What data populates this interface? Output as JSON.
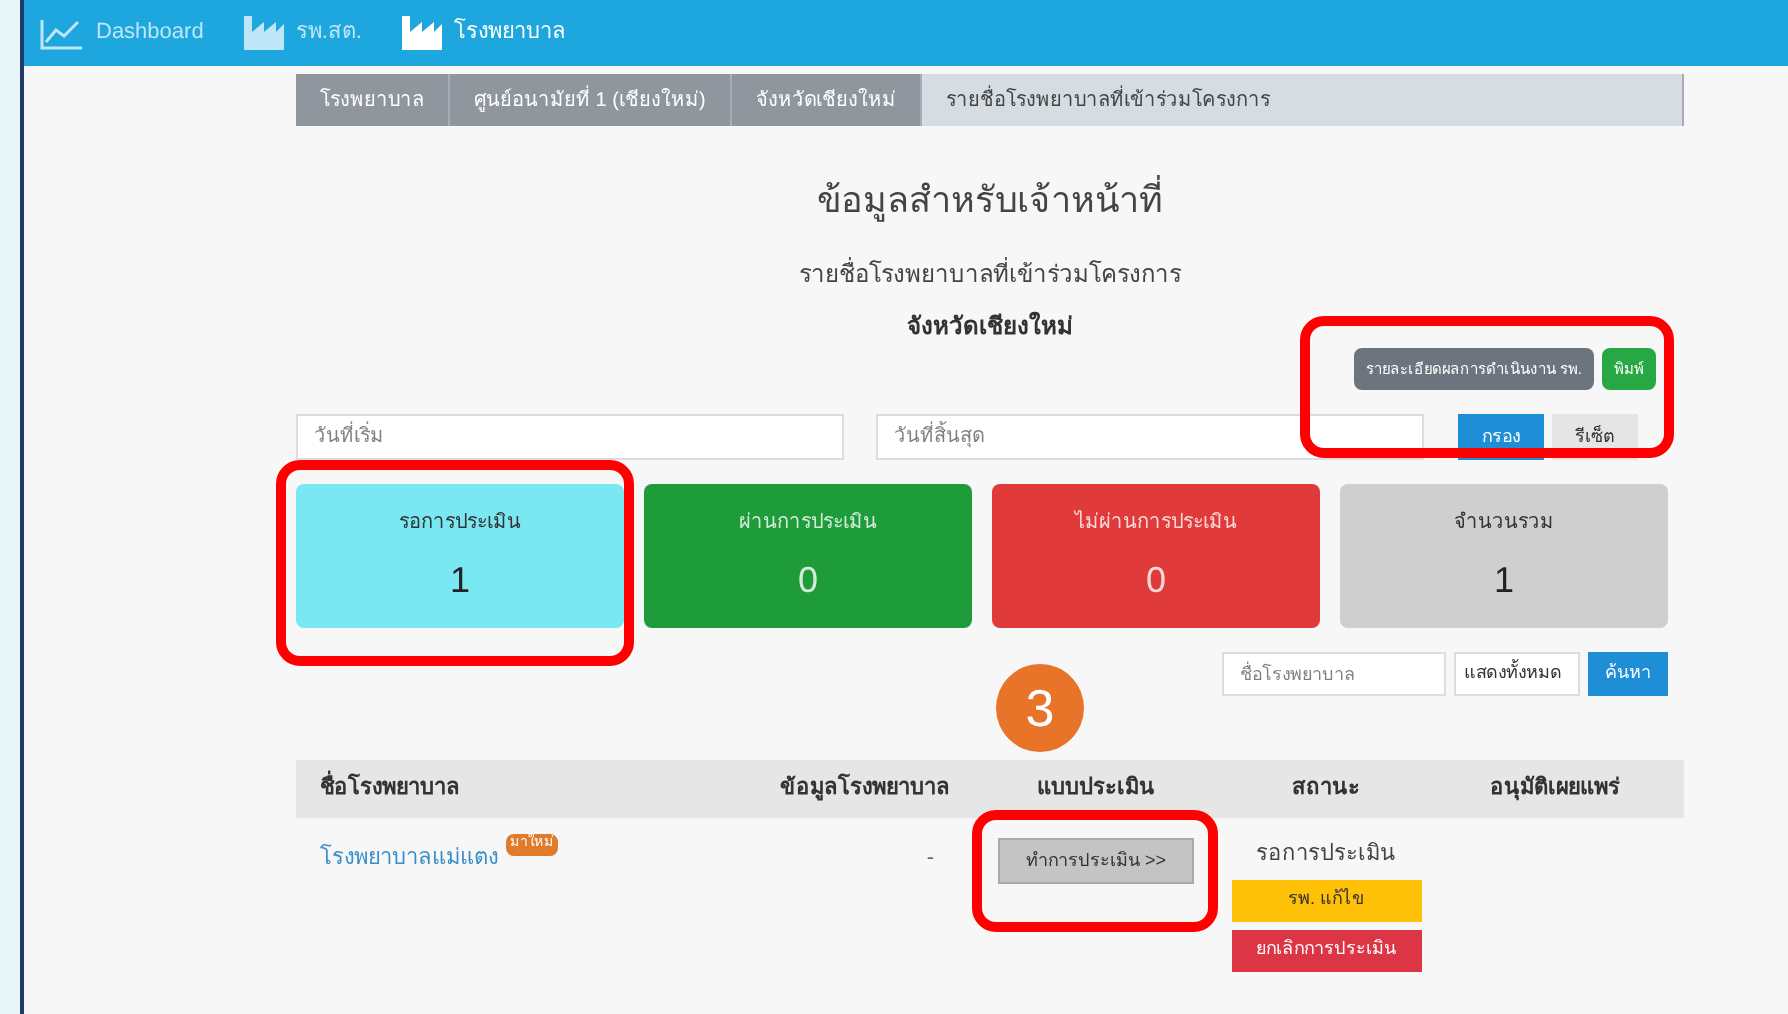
{
  "nav": [
    {
      "label": "Dashboard",
      "kind": "chart",
      "selected": false
    },
    {
      "label": "รพ.สต.",
      "kind": "factory",
      "selected": false
    },
    {
      "label": "โรงพยาบาล",
      "kind": "factory",
      "selected": true
    }
  ],
  "breadcrumb": [
    {
      "label": "โรงพยาบาล",
      "selected": false
    },
    {
      "label": "ศูนย์อนามัยที่ 1 (เชียงใหม่)",
      "selected": false
    },
    {
      "label": "จังหวัดเชียงใหม่",
      "selected": false
    },
    {
      "label": "รายชื่อโรงพยาบาลที่เข้าร่วมโครงการ",
      "selected": true
    }
  ],
  "title": "ข้อมูลสำหรับเจ้าหน้าที่",
  "subtitle": "รายชื่อโรงพยาบาลที่เข้าร่วมโครงการ",
  "province": "จังหวัดเชียงใหม่",
  "top_buttons": [
    {
      "label": "รายละเอียดผลการดำเนินงาน รพ.",
      "color": "#6c757d"
    },
    {
      "label": "พิมพ์",
      "color": "#28a745"
    }
  ],
  "date_filter": {
    "start": {
      "placeholder": "วันที่เริ่ม"
    },
    "end": {
      "placeholder": "วันที่สิ้นสุด"
    },
    "buttons": [
      {
        "label": "กรอง",
        "kind": "primary"
      },
      {
        "label": "รีเซ็ต",
        "kind": "light"
      }
    ]
  },
  "summary_cards": [
    {
      "label": "รอการประเมิน",
      "count": "1",
      "color": "#7ae8f3"
    },
    {
      "label": "ผ่านการประเมิน",
      "count": "0",
      "color": "#1e9c3a"
    },
    {
      "label": "ไม่ผ่านการประเมิน",
      "count": "0",
      "color": "#e03a3a"
    },
    {
      "label": "จำนวนรวม",
      "count": "1",
      "color": "#cfcfcf"
    }
  ],
  "search": {
    "placeholder": "ชื่อโรงพยาบาล",
    "select_value": "แสดงทั้งหมด",
    "button": "ค้นหา"
  },
  "table": {
    "columns": [
      "ชื่อโรงพยาบาล",
      "ข้อมูลโรงพยาบาล",
      "แบบประเมิน",
      "สถานะ",
      "อนุมัติเผยแพร่"
    ],
    "rows": [
      {
        "name": "โรงพยาบาลแม่แตง",
        "badge": "มาใหม่",
        "info": "-",
        "action": "ทำการประเมิน >>",
        "status": "รอการประเมิน",
        "status_buttons": [
          {
            "label": "รพ. แก้ไข",
            "color": "#ffc107"
          },
          {
            "label": "ยกเลิกการประเมิน",
            "color": "#dc3545"
          }
        ]
      }
    ]
  },
  "annotations": [
    {
      "kind": "frame"
    },
    {
      "kind": "frame"
    },
    {
      "kind": "frame"
    },
    {
      "kind": "step",
      "label": "3"
    }
  ]
}
